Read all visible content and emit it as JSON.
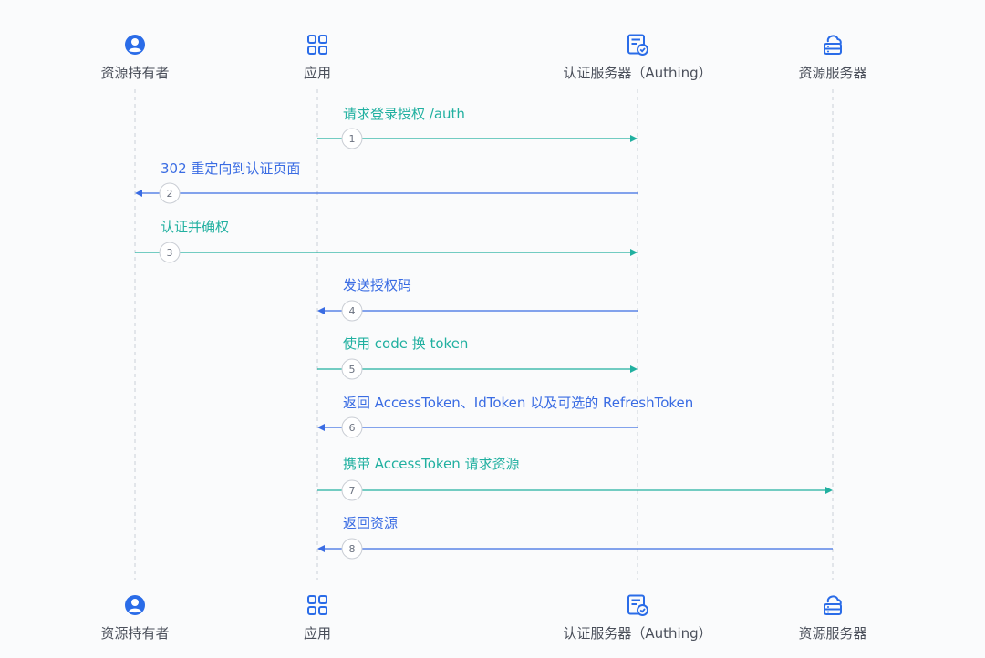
{
  "colors": {
    "actor_icon": "#2a6ce8",
    "lifeline": "#d3d7de",
    "request": "#21b0a0",
    "response": "#3a6ce3",
    "label_text": "#4a4f5a"
  },
  "participants": [
    {
      "id": "owner",
      "label": "资源持有者",
      "icon": "user-circle-icon"
    },
    {
      "id": "app",
      "label": "应用",
      "icon": "app-grid-icon"
    },
    {
      "id": "auth",
      "label": "认证服务器（Authing）",
      "icon": "auth-server-icon"
    },
    {
      "id": "resource",
      "label": "资源服务器",
      "icon": "cloud-server-icon"
    }
  ],
  "messages": [
    {
      "num": "1",
      "label": "请求登录授权 /auth",
      "from": "app",
      "to": "auth",
      "kind": "request"
    },
    {
      "num": "2",
      "label": "302 重定向到认证页面",
      "from": "auth",
      "to": "owner",
      "kind": "response"
    },
    {
      "num": "3",
      "label": "认证并确权",
      "from": "owner",
      "to": "auth",
      "kind": "request"
    },
    {
      "num": "4",
      "label": "发送授权码",
      "from": "auth",
      "to": "app",
      "kind": "response"
    },
    {
      "num": "5",
      "label": "使用 code 换 token",
      "from": "app",
      "to": "auth",
      "kind": "request"
    },
    {
      "num": "6",
      "label": "返回 AccessToken、IdToken 以及可选的 RefreshToken",
      "from": "auth",
      "to": "app",
      "kind": "response"
    },
    {
      "num": "7",
      "label": "携带 AccessToken 请求资源",
      "from": "app",
      "to": "resource",
      "kind": "request"
    },
    {
      "num": "8",
      "label": "返回资源",
      "from": "resource",
      "to": "app",
      "kind": "response"
    }
  ]
}
